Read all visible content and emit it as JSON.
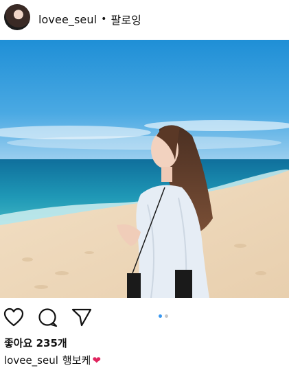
{
  "post": {
    "username": "lovee_seul",
    "separator": "•",
    "follow_label": "팔로잉"
  },
  "likes": {
    "text": "좋아요 235개"
  },
  "caption": {
    "username": "lovee_seul",
    "text": "행보케",
    "emoji": "❤"
  },
  "carousel": {
    "count": 2,
    "active_index": 0
  },
  "colors": {
    "accent": "#3897f0",
    "heart": "#e0245e"
  },
  "icons": {
    "like": "heart-outline-icon",
    "comment": "comment-bubble-icon",
    "share": "paper-plane-icon"
  }
}
